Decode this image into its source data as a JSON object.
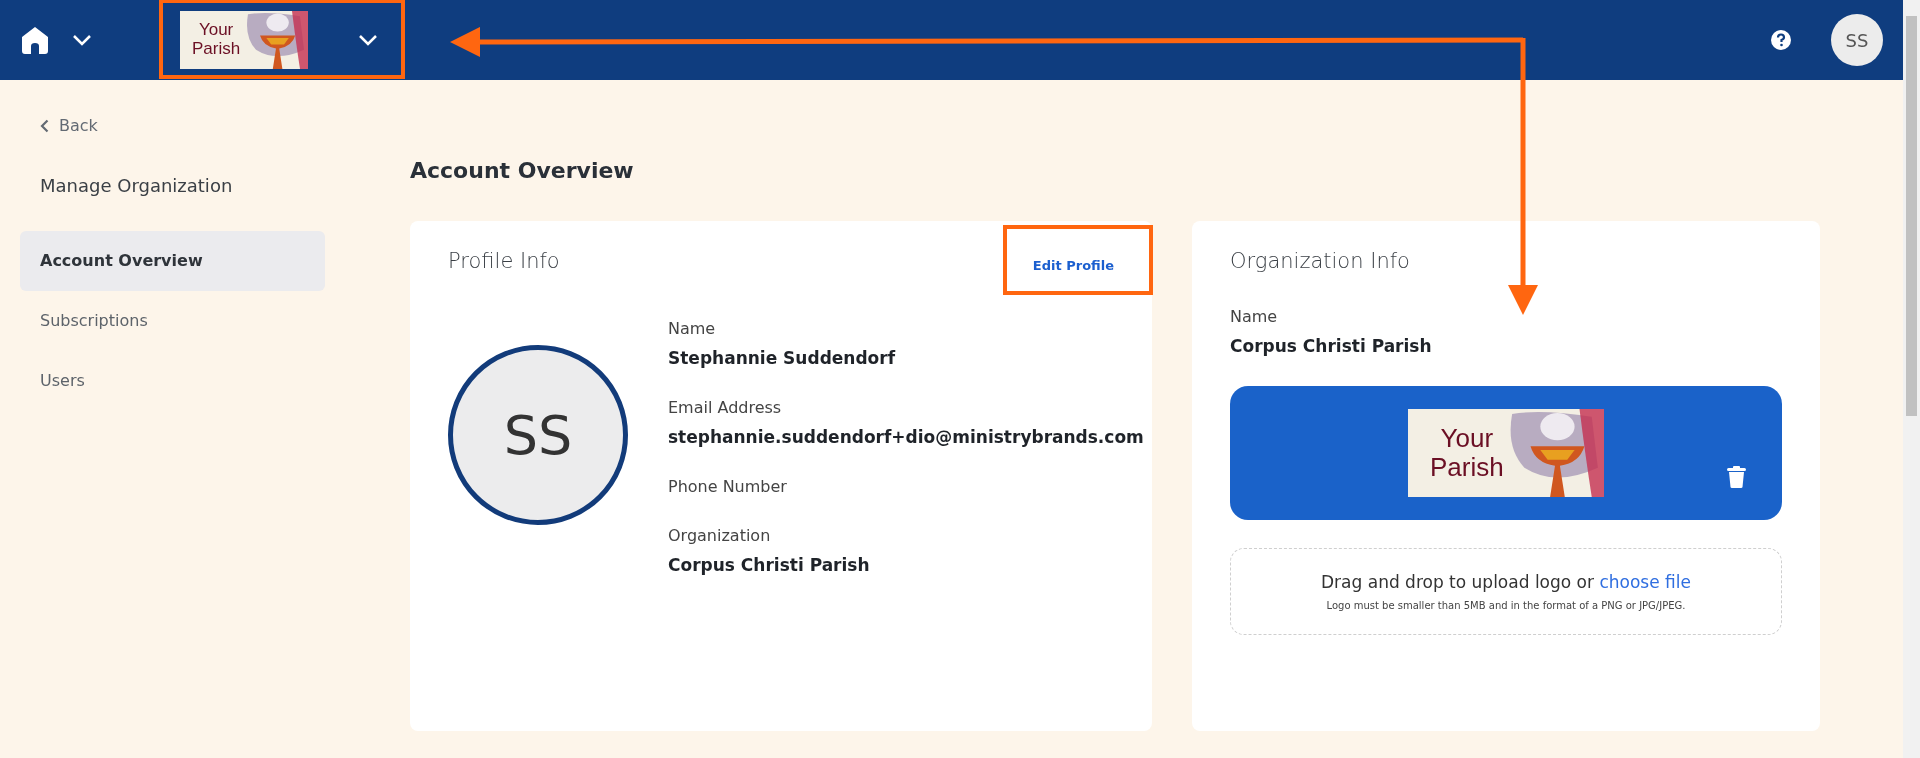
{
  "header": {
    "logo": {
      "line_1": "Your",
      "line_2": "Parish"
    },
    "avatar": "SS"
  },
  "sidebar": {
    "back": "Back",
    "title": "Manage Organization",
    "items": [
      {
        "label": "Account Overview",
        "selected": true
      },
      {
        "label": "Subscriptions",
        "selected": false
      },
      {
        "label": "Users",
        "selected": false
      }
    ]
  },
  "page_title": "Account Overview",
  "profile": {
    "title": "Profile Info",
    "edit": "Edit Profile",
    "avatar": "SS",
    "fields": [
      {
        "label": "Name",
        "value": "Stephannie Suddendorf"
      },
      {
        "label": "Email Address",
        "value": "stephannie.suddendorf+dio@ministrybrands.com"
      },
      {
        "label": "Phone Number"
      },
      {
        "label": "Organization",
        "value": "Corpus Christi Parish"
      }
    ]
  },
  "organization": {
    "title": "Organization Info",
    "name_label": "Name",
    "name": "Corpus Christi Parish",
    "logo": {
      "line_1": "Your",
      "line_2": "Parish"
    },
    "upload": {
      "text": "Drag and drop to upload logo or",
      "link": "choose file",
      "hint": "Logo must be smaller than 5MB and in the format of a PNG or JPG/JPEG."
    }
  }
}
